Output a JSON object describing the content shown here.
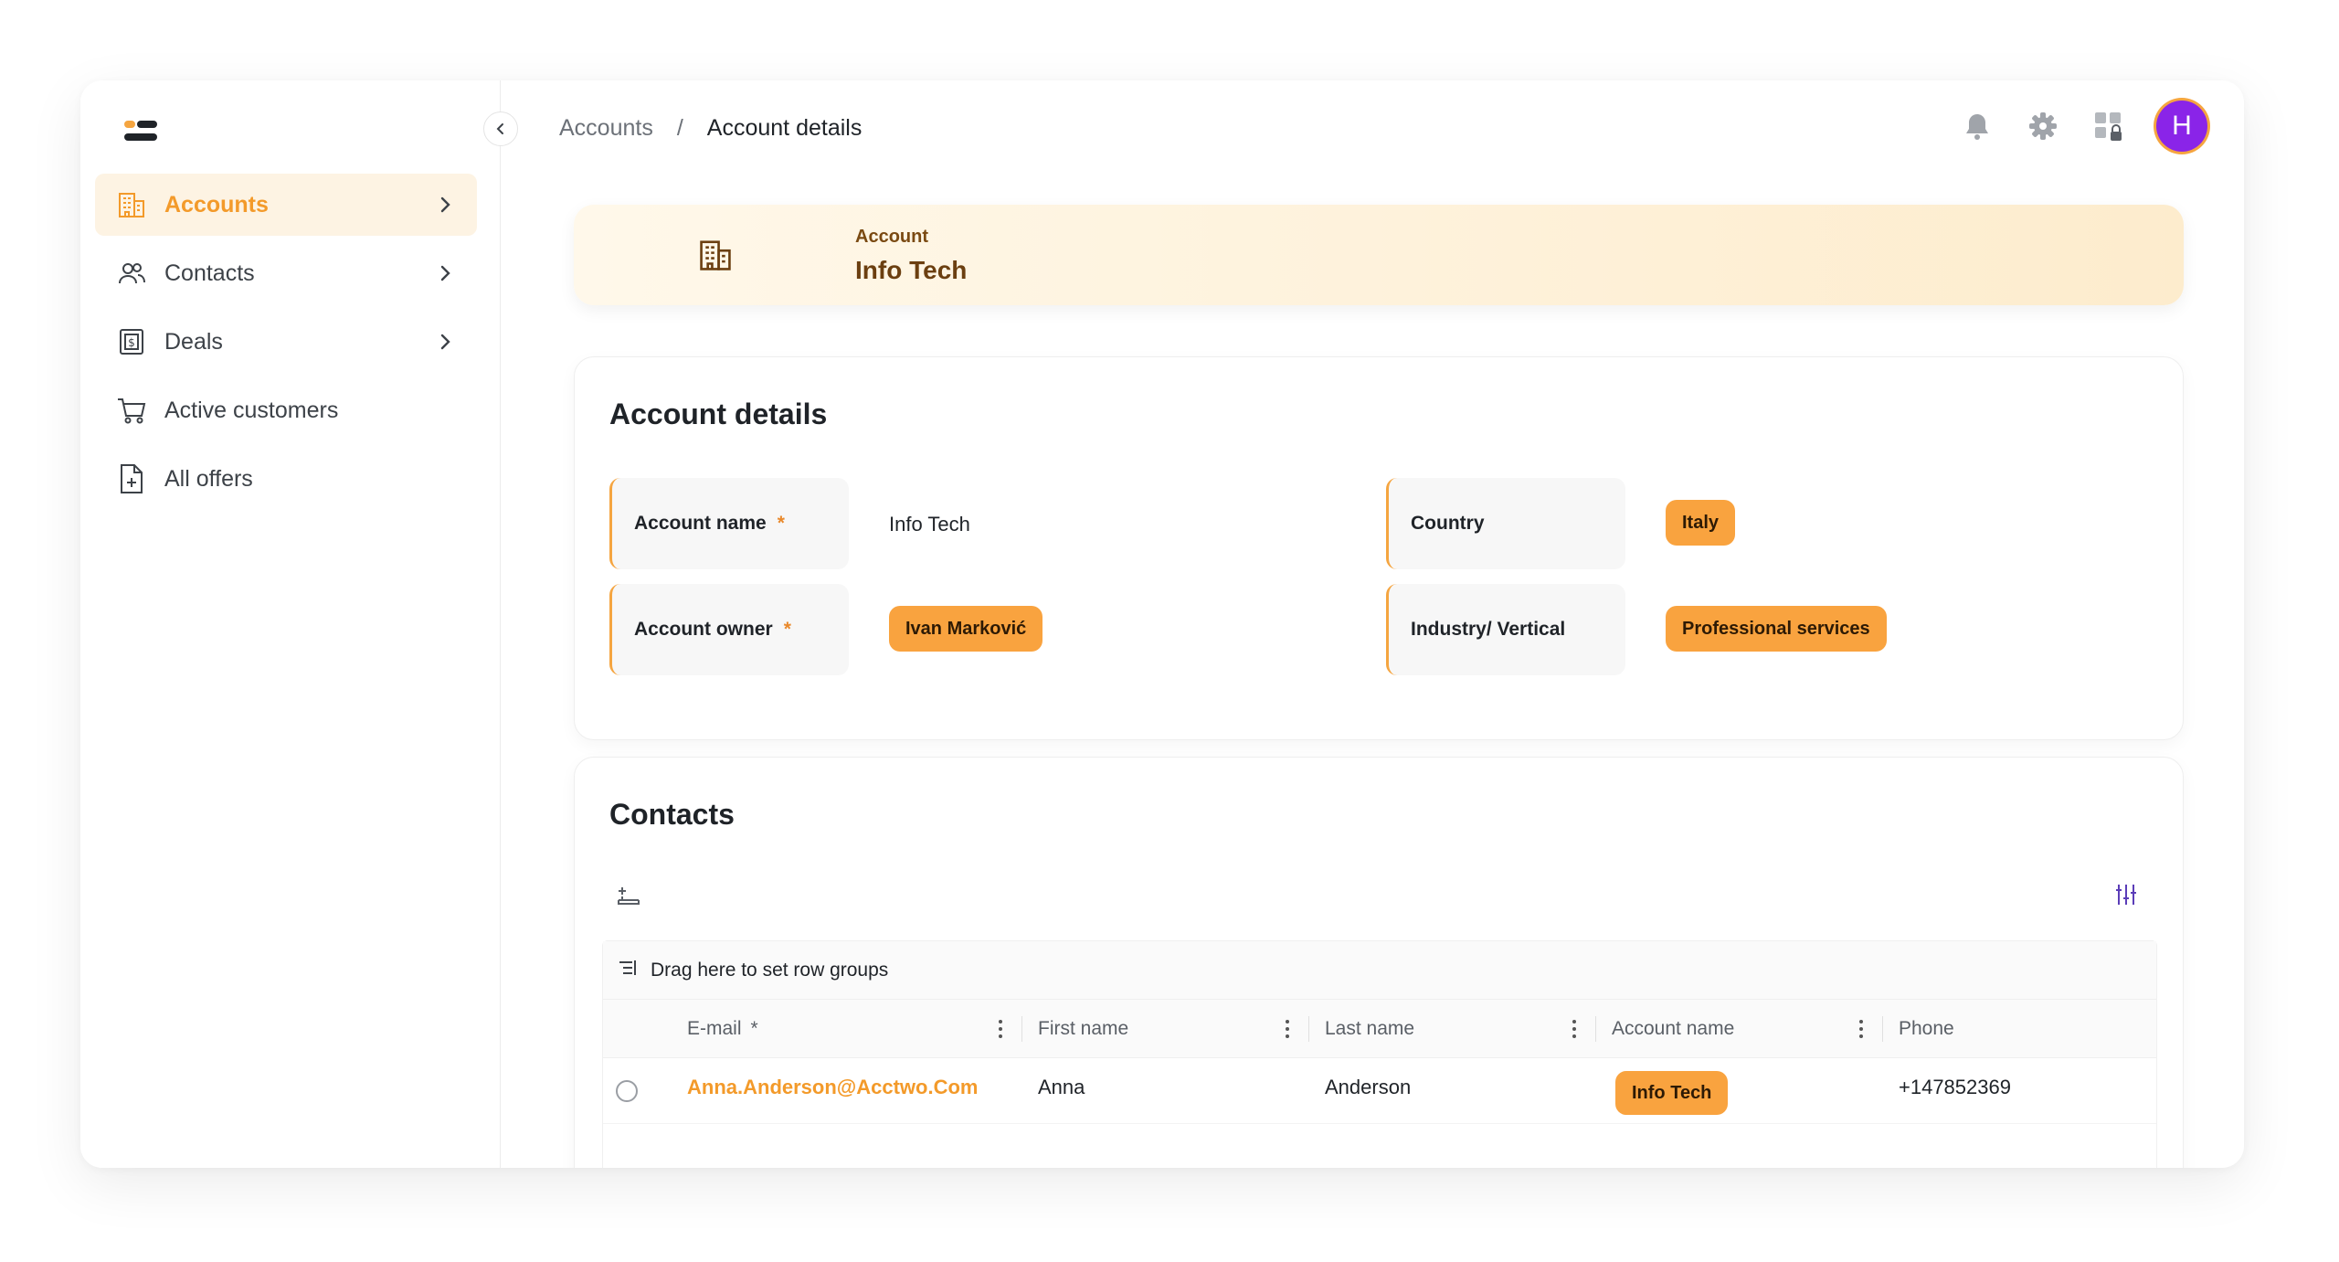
{
  "sidebar": {
    "items": [
      {
        "label": "Accounts",
        "icon": "building-icon",
        "active": true,
        "has_submenu": true
      },
      {
        "label": "Contacts",
        "icon": "users-icon",
        "active": false,
        "has_submenu": true
      },
      {
        "label": "Deals",
        "icon": "dollar-doc-icon",
        "active": false,
        "has_submenu": true
      },
      {
        "label": "Active customers",
        "icon": "cart-icon",
        "active": false,
        "has_submenu": false
      },
      {
        "label": "All offers",
        "icon": "file-plus-icon",
        "active": false,
        "has_submenu": false
      }
    ]
  },
  "breadcrumb": {
    "root": "Accounts",
    "separator": "/",
    "current": "Account details"
  },
  "topbar": {
    "avatar_initial": "H",
    "avatar_color": "#8a24e8"
  },
  "banner": {
    "kicker": "Account",
    "title": "Info Tech"
  },
  "details": {
    "title": "Account details",
    "fields": {
      "account_name": {
        "label": "Account name",
        "required": "*",
        "value": "Info Tech"
      },
      "account_owner": {
        "label": "Account owner",
        "required": "*",
        "value": "Ivan Marković"
      },
      "country": {
        "label": "Country",
        "value": "Italy"
      },
      "industry": {
        "label": "Industry/ Vertical",
        "value": "Professional services"
      }
    }
  },
  "contacts": {
    "title": "Contacts",
    "group_panel": "Drag here to set row groups",
    "columns": [
      {
        "label": "E-mail",
        "required": "*"
      },
      {
        "label": "First name"
      },
      {
        "label": "Last name"
      },
      {
        "label": "Account name"
      },
      {
        "label": "Phone"
      }
    ],
    "rows": [
      {
        "email": "Anna.Anderson@Acctwo.Com",
        "first_name": "Anna",
        "last_name": "Anderson",
        "account_name": "Info Tech",
        "phone": "+147852369"
      }
    ]
  },
  "colors": {
    "accent": "#f5a540",
    "chip": "#f9a33f",
    "link": "#f39a2a",
    "avatar": "#8a24e8"
  }
}
